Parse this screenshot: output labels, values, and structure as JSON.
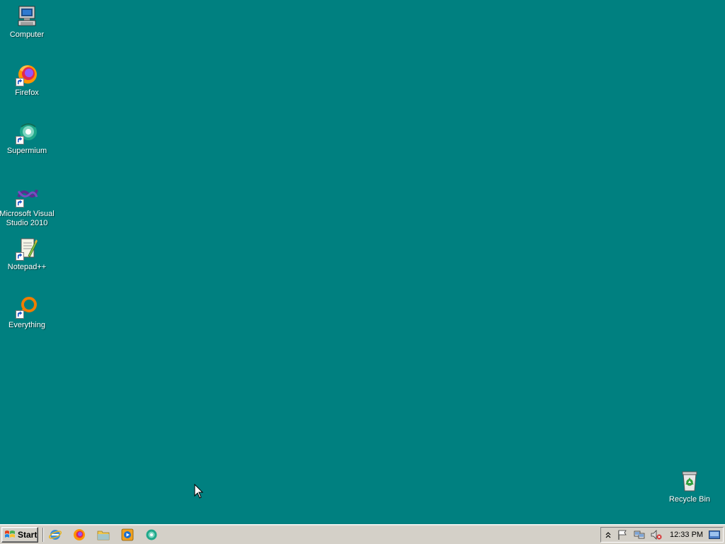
{
  "desktop": {
    "background": "#008080",
    "icons": [
      {
        "label": "Computer",
        "icon": "computer-icon"
      },
      {
        "label": "Firefox",
        "icon": "firefox-icon"
      },
      {
        "label": "Supermium",
        "icon": "supermium-icon"
      },
      {
        "label": "Microsoft Visual Studio 2010",
        "icon": "visual-studio-icon"
      },
      {
        "label": "Notepad++",
        "icon": "notepadpp-icon"
      },
      {
        "label": "Everything",
        "icon": "everything-icon"
      }
    ],
    "recycle_bin": {
      "label": "Recycle Bin",
      "icon": "recycle-bin-icon"
    }
  },
  "taskbar": {
    "start_label": "Start",
    "quick_launch": [
      {
        "icon": "internet-explorer-icon"
      },
      {
        "icon": "firefox-icon"
      },
      {
        "icon": "file-explorer-icon"
      },
      {
        "icon": "media-player-icon"
      },
      {
        "icon": "supermium-icon"
      }
    ],
    "tray": {
      "icons": [
        "show-hidden-icon",
        "action-center-flag-icon",
        "network-icon",
        "volume-muted-icon"
      ],
      "clock": "12:33 PM"
    }
  }
}
